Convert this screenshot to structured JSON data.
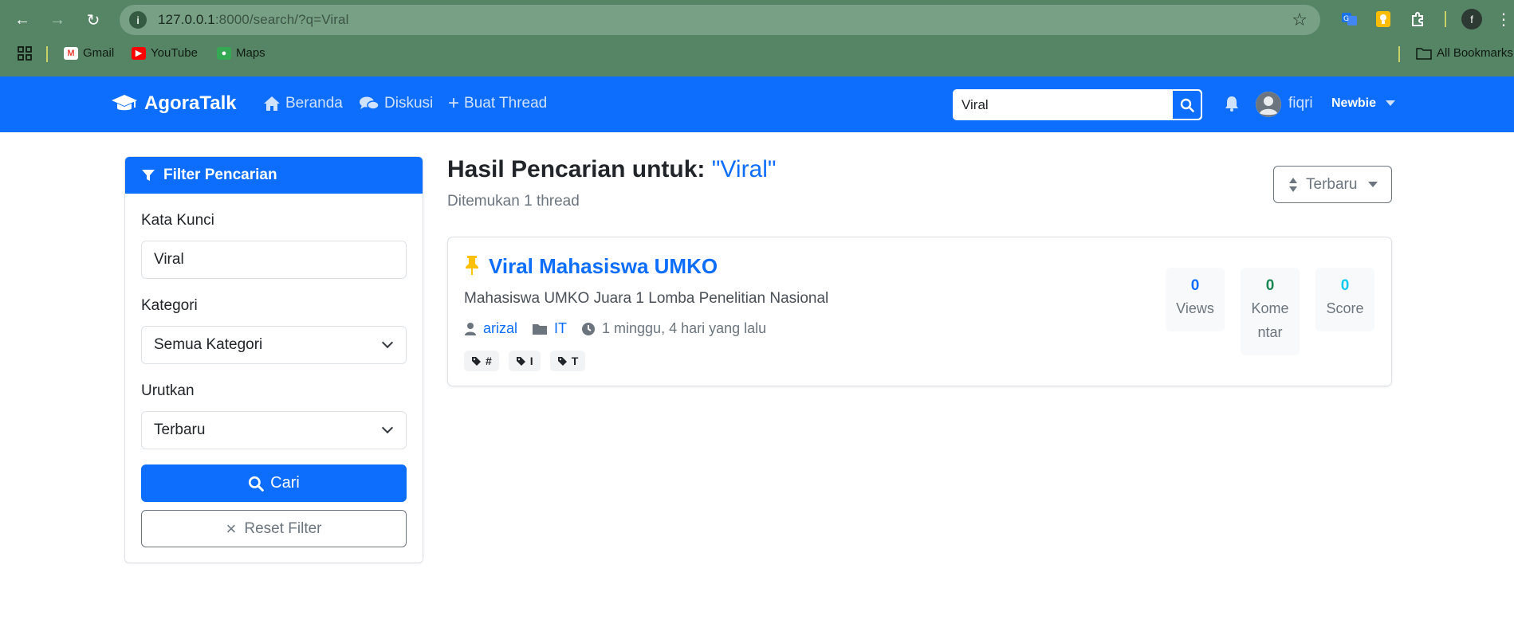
{
  "browser": {
    "url_host": "127.0.0.1",
    "url_rest": ":8000/search/?q=Viral",
    "profile_initial": "f",
    "bookmarks": [
      {
        "label": "Gmail",
        "icon": "gmail-icon"
      },
      {
        "label": "YouTube",
        "icon": "youtube-icon"
      },
      {
        "label": "Maps",
        "icon": "maps-icon"
      }
    ],
    "all_bookmarks": "All Bookmarks"
  },
  "navbar": {
    "brand": "AgoraTalk",
    "links": [
      {
        "label": "Beranda",
        "icon": "home-icon"
      },
      {
        "label": "Diskusi",
        "icon": "comments-icon"
      },
      {
        "label": "Buat Thread",
        "icon": "plus-icon"
      }
    ],
    "search_value": "Viral",
    "username": "fiqri",
    "level": "Newbie"
  },
  "filter": {
    "header": "Filter Pencarian",
    "keyword_label": "Kata Kunci",
    "keyword_value": "Viral",
    "category_label": "Kategori",
    "category_value": "Semua Kategori",
    "sort_label": "Urutkan",
    "sort_value": "Terbaru",
    "search_button": "Cari",
    "reset_button": "Reset Filter"
  },
  "results": {
    "title_prefix": "Hasil Pencarian untuk:",
    "query": "\"Viral\"",
    "count_text": "Ditemukan 1 thread",
    "sort_button": "Terbaru",
    "threads": [
      {
        "title": "Viral Mahasiswa UMKO",
        "description": "Mahasiswa UMKO Juara 1 Lomba Penelitian Nasional",
        "author": "arizal",
        "category": "IT",
        "time": "1 minggu, 4 hari yang lalu",
        "tags": [
          "#",
          "I",
          "T"
        ],
        "stats": {
          "views": "0",
          "views_label": "Views",
          "comments": "0",
          "comments_label_1": "Kome",
          "comments_label_2": "ntar",
          "score": "0",
          "score_label": "Score"
        }
      }
    ]
  },
  "colors": {
    "primary": "#0d6efd",
    "success": "#198754",
    "info": "#0dcaf0",
    "pin": "#ffc107",
    "chrome": "#568565"
  }
}
